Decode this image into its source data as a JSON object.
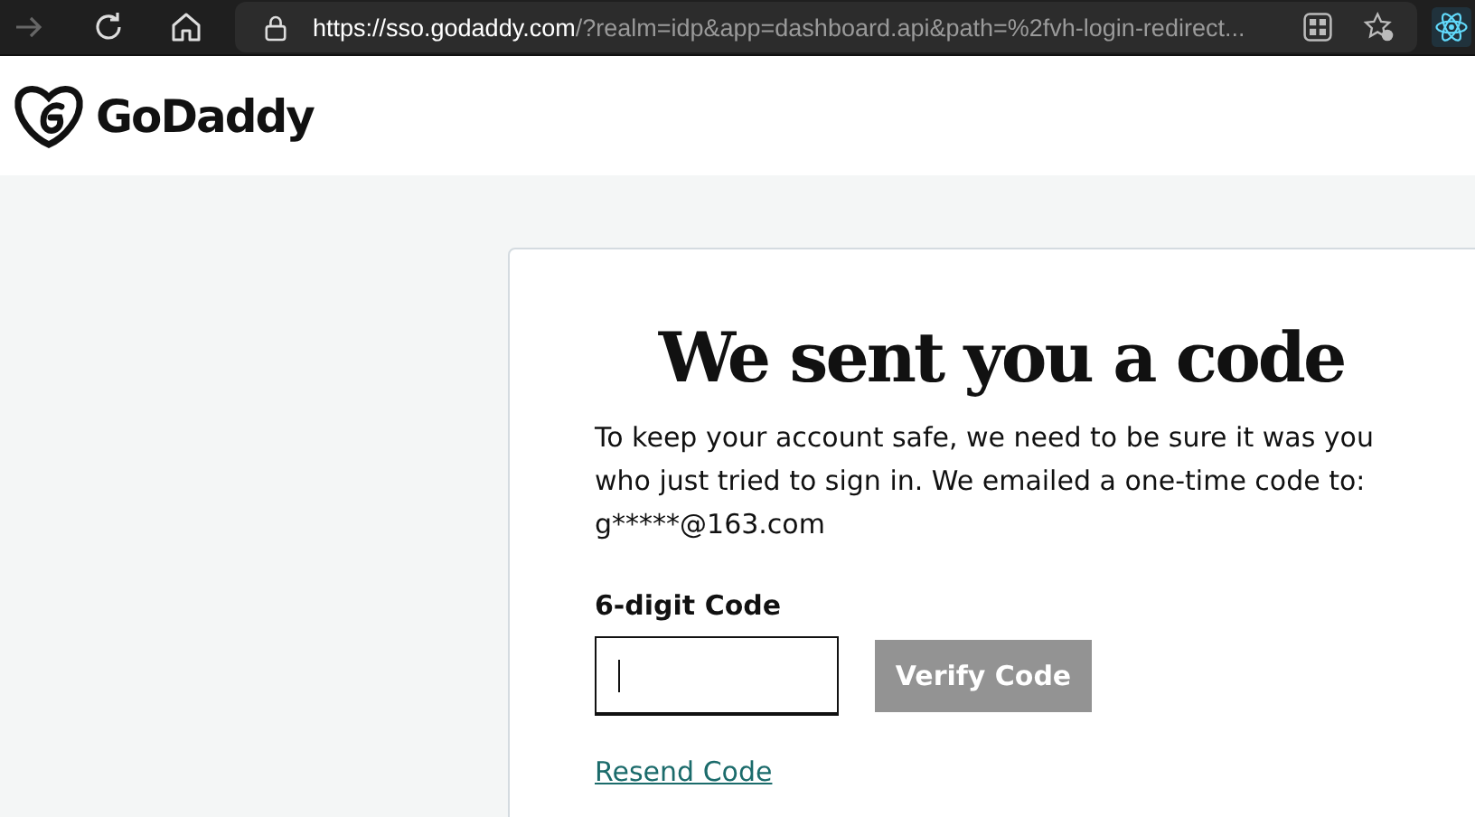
{
  "browser": {
    "url_host": "https://sso.godaddy.com",
    "url_path": "/?realm=idp&app=dashboard.api&path=%2fvh-login-redirect..."
  },
  "header": {
    "logo": "GoDaddy"
  },
  "card": {
    "title": "We sent you a code",
    "message": "To keep your account safe, we need to be sure it was you who just tried to sign in. We emailed a one-time code to: g*****@163.com",
    "field": {
      "label": "6-digit Code"
    },
    "verify_button": {
      "label": "Verify Code",
      "disabled": true
    },
    "resend_link": "Resend Code"
  }
}
